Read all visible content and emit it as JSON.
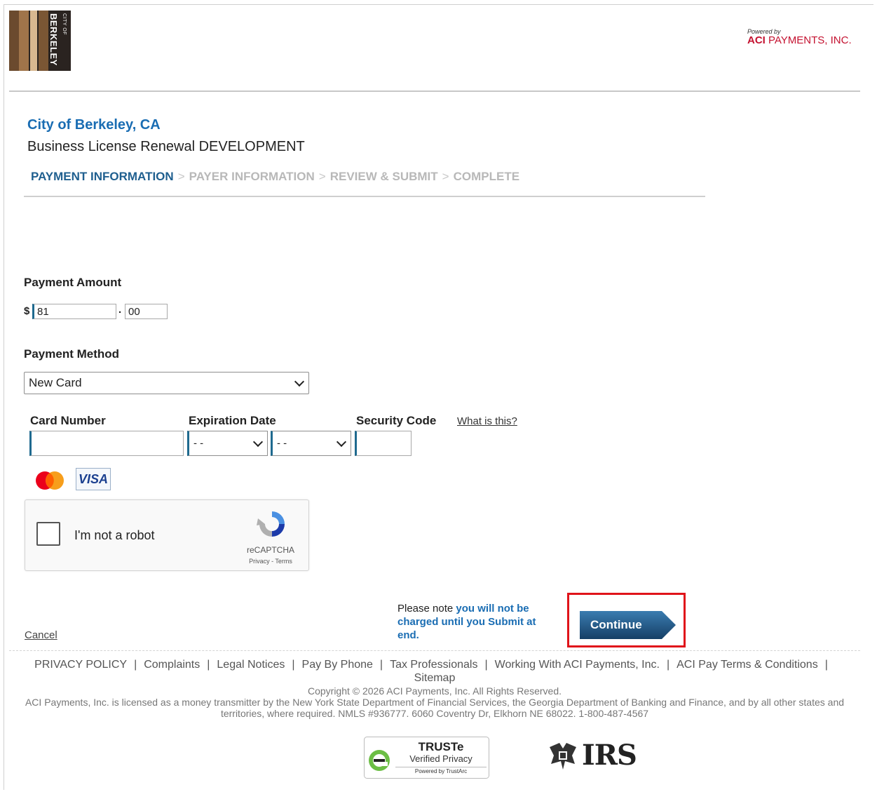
{
  "header": {
    "logo_text": "BERKELEY",
    "logo_small": "CITY OF",
    "powered_by": "Powered by",
    "aci_brand": "ACI",
    "aci_name": " PAYMENTS, INC."
  },
  "title": {
    "organization": "City of Berkeley, CA",
    "application": "Business License Renewal DEVELOPMENT"
  },
  "steps": [
    {
      "label": "PAYMENT INFORMATION",
      "active": true
    },
    {
      "label": "PAYER INFORMATION",
      "active": false
    },
    {
      "label": "REVIEW & SUBMIT",
      "active": false
    },
    {
      "label": "COMPLETE",
      "active": false
    }
  ],
  "step_separator": ">",
  "payment_amount": {
    "label": "Payment Amount",
    "currency_symbol": "$",
    "whole_value": "81",
    "decimal_point": ".",
    "cents_value": "00"
  },
  "payment_method": {
    "label": "Payment Method",
    "selected": "New Card"
  },
  "card": {
    "card_number_label": "Card Number",
    "card_number_value": "",
    "expiration_label": "Expiration Date",
    "exp_month_selected": "- -",
    "exp_year_selected": "- -",
    "security_code_label": "Security Code",
    "security_code_value": "",
    "what_is_this": "What is this?",
    "accepted_cards": [
      "mastercard-icon",
      "visa-icon"
    ],
    "visa_text": "VISA"
  },
  "captcha": {
    "label": "I'm not a robot",
    "brand": "reCAPTCHA",
    "links": "Privacy - Terms"
  },
  "actions": {
    "cancel": "Cancel",
    "note_prefix": "Please note ",
    "note_highlight": "you will not be charged until you Submit at end.",
    "continue": "Continue"
  },
  "footer": {
    "links": [
      "PRIVACY POLICY",
      "Complaints",
      "Legal Notices",
      "Pay By Phone",
      "Tax Professionals",
      "Working With ACI Payments, Inc.",
      "ACI Pay Terms & Conditions",
      "Sitemap"
    ],
    "link_separator": "|",
    "copyright": "Copyright © 2026 ACI Payments, Inc. All Rights Reserved.",
    "license": "ACI Payments, Inc. is licensed as a money transmitter by the New York State Department of Financial Services, the Georgia Department of Banking and Finance, and by all other states and territories, where required. NMLS #936777. 6060 Coventry Dr, Elkhorn NE 68022. 1-800-487-4567",
    "truste_title": "TRUSTe",
    "truste_sub": "Verified Privacy",
    "truste_powered": "Powered by TrustArc",
    "irs_text": "IRS"
  },
  "colors": {
    "link_blue": "#1a6db3",
    "active_step": "#1f5f8f",
    "button_blue": "#1f5f8f",
    "highlight_red": "#e0131a",
    "aci_red": "#c41230"
  }
}
